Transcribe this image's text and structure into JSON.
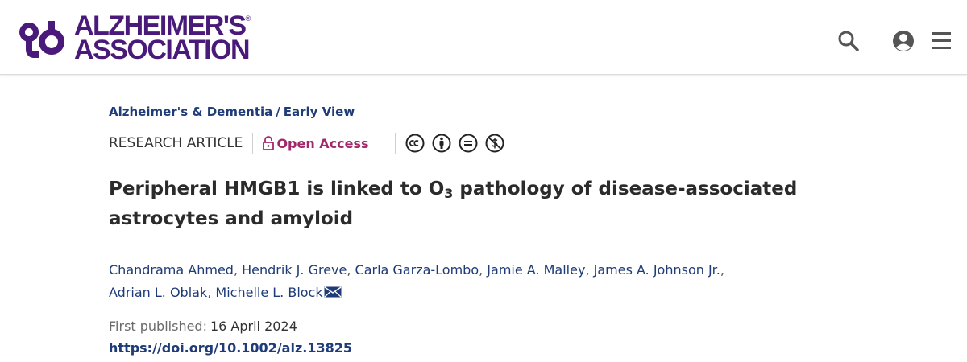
{
  "header": {
    "logo": {
      "line1": "ALZHEIMER'S",
      "line2": "ASSOCIATION",
      "registered_mark": "®",
      "color": "#4a1a7a"
    },
    "icons": [
      "search-icon",
      "user-account-icon",
      "hamburger-menu-icon"
    ]
  },
  "breadcrumb": {
    "journal": "Alzheimer's & Dementia",
    "separator": "/",
    "section": "Early View"
  },
  "article_meta": {
    "type": "RESEARCH ARTICLE",
    "access": "Open Access",
    "license_icons": [
      "cc-icon",
      "attribution-icon",
      "no-derivatives-icon",
      "non-commercial-icon"
    ]
  },
  "title": {
    "part1": "Peripheral HMGB1 is linked to O",
    "subscript": "3",
    "part2": " pathology of disease-associated astrocytes and amyloid"
  },
  "authors": [
    "Chandrama Ahmed",
    "Hendrik J. Greve",
    "Carla Garza-Lombo",
    "Jamie A. Malley",
    "James A. Johnson Jr.",
    "Adrian L. Oblak",
    "Michelle L. Block"
  ],
  "publication": {
    "first_published_label": "First published:",
    "first_published_date": "16 April 2024",
    "doi": "https://doi.org/10.1002/alz.13825"
  },
  "colors": {
    "link_blue": "#1f3b78",
    "open_access_magenta": "#a1286a",
    "brand_purple": "#4a1a7a"
  }
}
